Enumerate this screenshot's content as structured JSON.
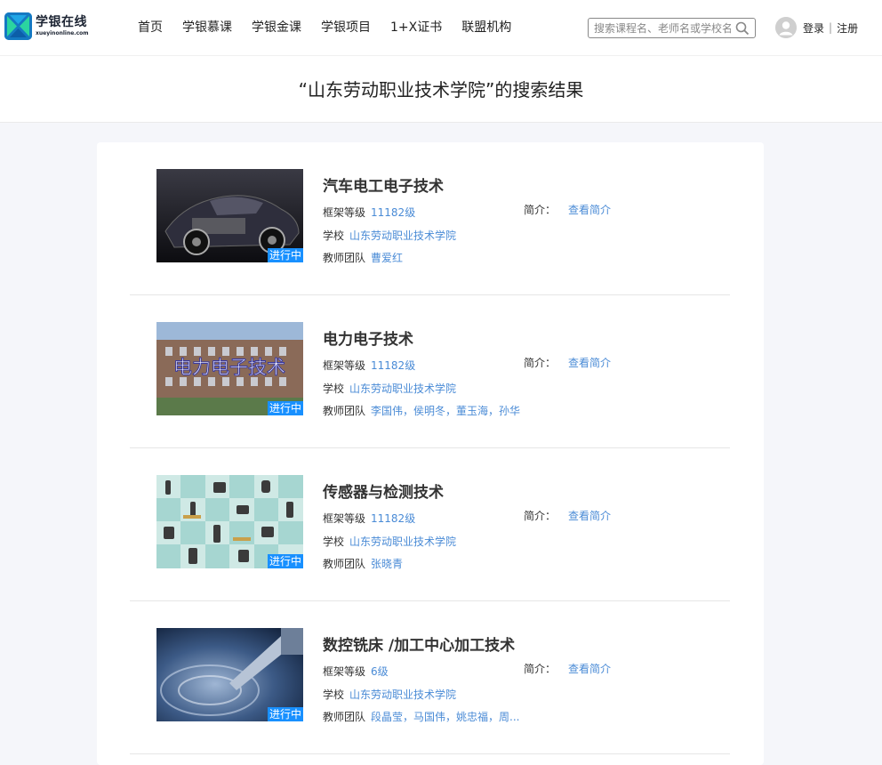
{
  "logo": {
    "title": "学银在线",
    "subtitle": "xueyinonline.com"
  },
  "nav": [
    "首页",
    "学银慕课",
    "学银金课",
    "学银项目",
    "1+X证书",
    "联盟机构"
  ],
  "search": {
    "placeholder": "搜索课程名、老师名或学校名"
  },
  "auth": {
    "login": "登录",
    "separator": "|",
    "register": "注册"
  },
  "page_title": "“山东劳动职业技术学院”的搜索结果",
  "labels": {
    "level": "框架等级",
    "school": "学校",
    "team": "教师团队",
    "intro": "简介：",
    "view_intro": "查看简介",
    "status": "进行中"
  },
  "courses": [
    {
      "title": "汽车电工电子技术",
      "level": "11182级",
      "school": "山东劳动职业技术学院",
      "team": "曹爱红"
    },
    {
      "title": "电力电子技术",
      "level": "11182级",
      "school": "山东劳动职业技术学院",
      "team": "李国伟，侯明冬，董玉海，孙华"
    },
    {
      "title": "传感器与检测技术",
      "level": "11182级",
      "school": "山东劳动职业技术学院",
      "team": "张晓青"
    },
    {
      "title": "数控铣床 /加工中心加工技术",
      "level": "6级",
      "school": "山东劳动职业技术学院",
      "team": "段晶莹，马国伟，姚忠福，周..."
    }
  ],
  "thumb_text": {
    "c2": "电力电子技术"
  },
  "colors": {
    "link": "#4a8bd6",
    "badge": "#1890ff"
  }
}
